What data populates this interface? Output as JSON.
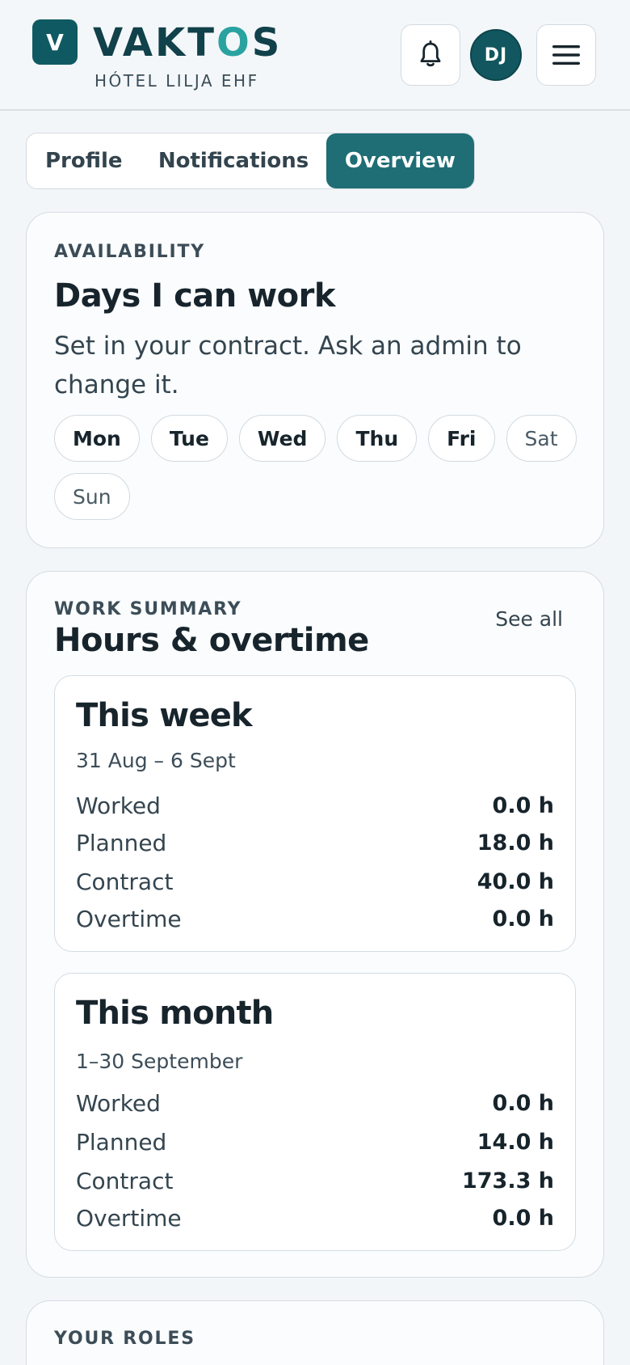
{
  "header": {
    "logo_letter": "V",
    "brand_main": "VAKT",
    "brand_accent": "O",
    "brand_end": "S",
    "subtitle": "HÓTEL LILJA EHF",
    "avatar_initials": "DJ",
    "icons": [
      "bell-icon",
      "menu-icon"
    ]
  },
  "tabs": [
    {
      "label": "Profile",
      "active": false
    },
    {
      "label": "Notifications",
      "active": false
    },
    {
      "label": "Overview",
      "active": true
    }
  ],
  "availability": {
    "overline": "AVAILABILITY",
    "title": "Days I can work",
    "description": "Set in your contract. Ask an admin to change it.",
    "days": [
      {
        "label": "Mon",
        "selected": true
      },
      {
        "label": "Tue",
        "selected": true
      },
      {
        "label": "Wed",
        "selected": true
      },
      {
        "label": "Thu",
        "selected": true
      },
      {
        "label": "Fri",
        "selected": true
      },
      {
        "label": "Sat",
        "selected": false
      },
      {
        "label": "Sun",
        "selected": false
      }
    ]
  },
  "work_summary": {
    "overline": "WORK SUMMARY",
    "title": "Hours & overtime",
    "see_all": "See all",
    "week": {
      "title": "This week",
      "range": "31 Aug – 6 Sept",
      "rows": [
        {
          "label": "Worked",
          "value": "0.0 h"
        },
        {
          "label": "Planned",
          "value": "18.0 h"
        },
        {
          "label": "Contract",
          "value": "40.0 h"
        },
        {
          "label": "Overtime",
          "value": "0.0 h"
        }
      ]
    },
    "month": {
      "title": "This month",
      "range": "1–30 September",
      "rows": [
        {
          "label": "Worked",
          "value": "0.0 h"
        },
        {
          "label": "Planned",
          "value": "14.0 h"
        },
        {
          "label": "Contract",
          "value": "173.3 h"
        },
        {
          "label": "Overtime",
          "value": "0.0 h"
        }
      ]
    }
  },
  "roles": {
    "overline": "YOUR ROLES"
  },
  "colors": {
    "brand": "#0f5a62",
    "accent": "#2aa3a0",
    "active_tab": "#1f6d75",
    "background": "#f3f6f9"
  }
}
